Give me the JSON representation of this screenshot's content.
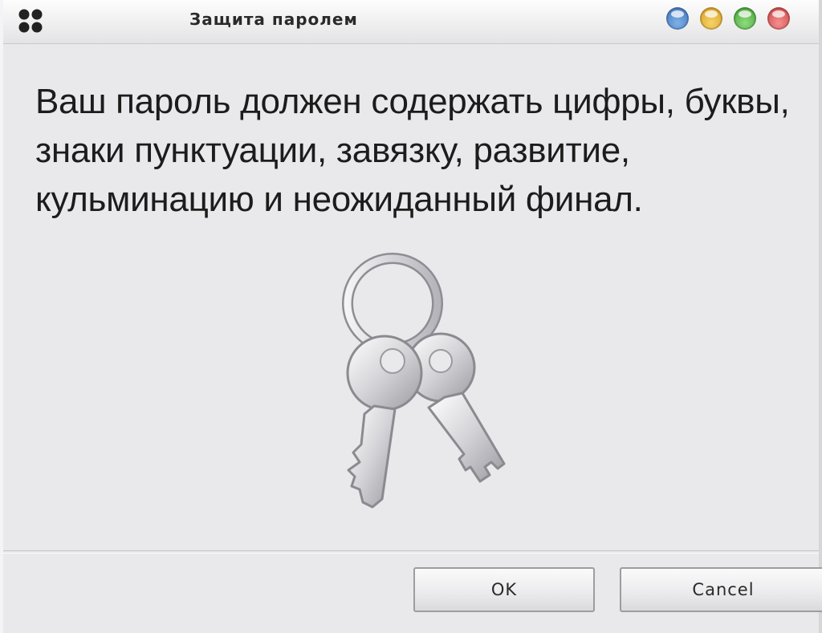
{
  "window": {
    "title": "Защита паролем",
    "app_icon": "clover-icon",
    "controls": [
      "minimize-icon",
      "maximize-icon",
      "help-icon",
      "close-icon"
    ]
  },
  "dialog": {
    "message": "Ваш пароль должен содержать цифры, буквы, знаки пунктуации, завязку, развитие, кульминацию и неожиданный финал.",
    "illustration_icon": "keys-icon"
  },
  "buttons": {
    "ok_label": "OK",
    "cancel_label": "Cancel"
  },
  "colors": {
    "window_bg": "#e9e9eb",
    "text": "#1c1c1c",
    "control_blue": "#3a6fb6",
    "control_yellow": "#d39a18",
    "control_green": "#3d9a2f",
    "control_red": "#c73c3c"
  }
}
